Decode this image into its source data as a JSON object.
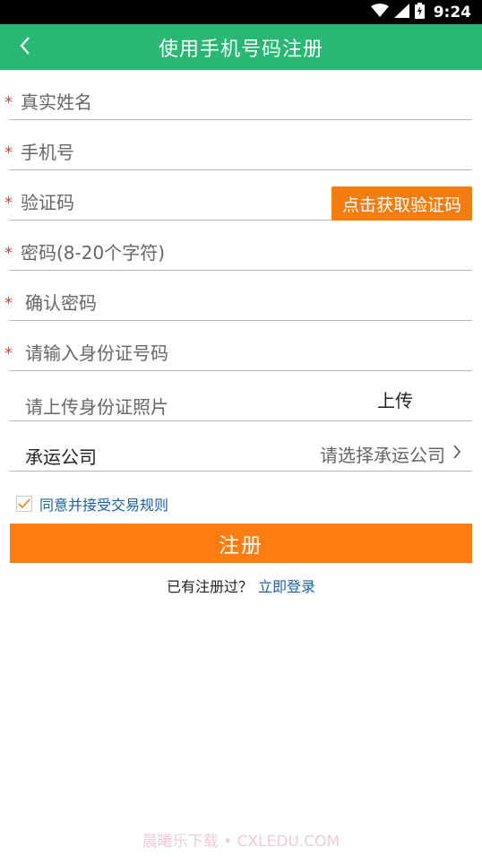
{
  "status_bar": {
    "time": "9:24",
    "icons": [
      "wifi-icon",
      "signal-icon",
      "battery-icon"
    ]
  },
  "header": {
    "title": "使用手机号码注册",
    "back_icon": "chevron-left-icon"
  },
  "form": {
    "name": {
      "placeholder": "真实姓名"
    },
    "phone": {
      "placeholder": "手机号"
    },
    "code": {
      "placeholder": "验证码",
      "button_label": "点击获取验证码"
    },
    "password": {
      "placeholder": "密码(8-20个字符)"
    },
    "confirm_password": {
      "placeholder": "确认密码"
    },
    "id_number": {
      "placeholder": "请输入身份证号码"
    },
    "id_photo": {
      "label": "请上传身份证照片",
      "upload_label": "上传"
    },
    "company": {
      "label": "承运公司",
      "placeholder": "请选择承运公司"
    },
    "required_mark": "*"
  },
  "agreement": {
    "text": "同意并接受交易规则",
    "checked": true
  },
  "submit": {
    "label": "注册"
  },
  "login": {
    "prompt": "已有注册过？",
    "link": "立即登录"
  },
  "watermark": "晨曦乐下载 • CXLEDU.COM",
  "colors": {
    "header": "#28b873",
    "accent": "#fe7d10",
    "link": "#1a5fa8",
    "required": "#e23b3b"
  }
}
